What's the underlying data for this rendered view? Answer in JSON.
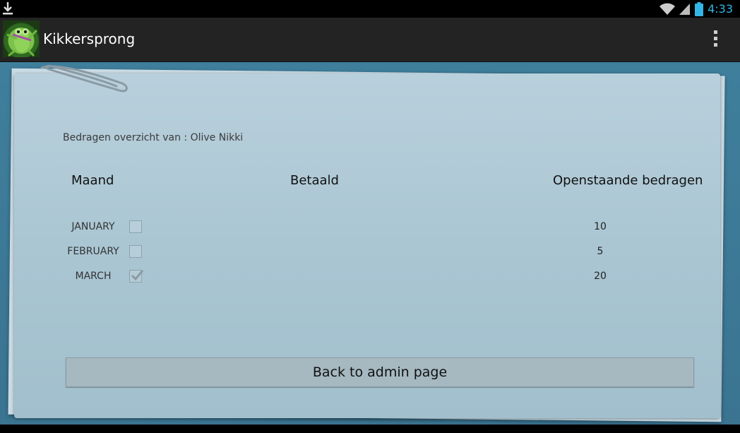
{
  "status_bar": {
    "time": "4:33",
    "icons": [
      "download-icon",
      "wifi-icon",
      "signal-icon",
      "battery-icon"
    ]
  },
  "action_bar": {
    "title": "Kikkersprong",
    "app_icon": "frog-app-icon",
    "menu_icon": "overflow-menu-icon"
  },
  "overview": {
    "subtitle": "Bedragen overzicht van : Olive Nikki",
    "columns": {
      "month": "Maand",
      "paid": "Betaald",
      "outstanding": "Openstaande bedragen"
    },
    "rows": [
      {
        "month": "JANUARY",
        "paid": false,
        "amount": "10"
      },
      {
        "month": "FEBRUARY",
        "paid": false,
        "amount": "5"
      },
      {
        "month": "MARCH",
        "paid": true,
        "amount": "20"
      }
    ]
  },
  "back_button_label": "Back to admin page",
  "colors": {
    "accent": "#33b5e5",
    "action_bar": "#232323",
    "background": "#3a7491",
    "paper": "#b0cad7"
  }
}
